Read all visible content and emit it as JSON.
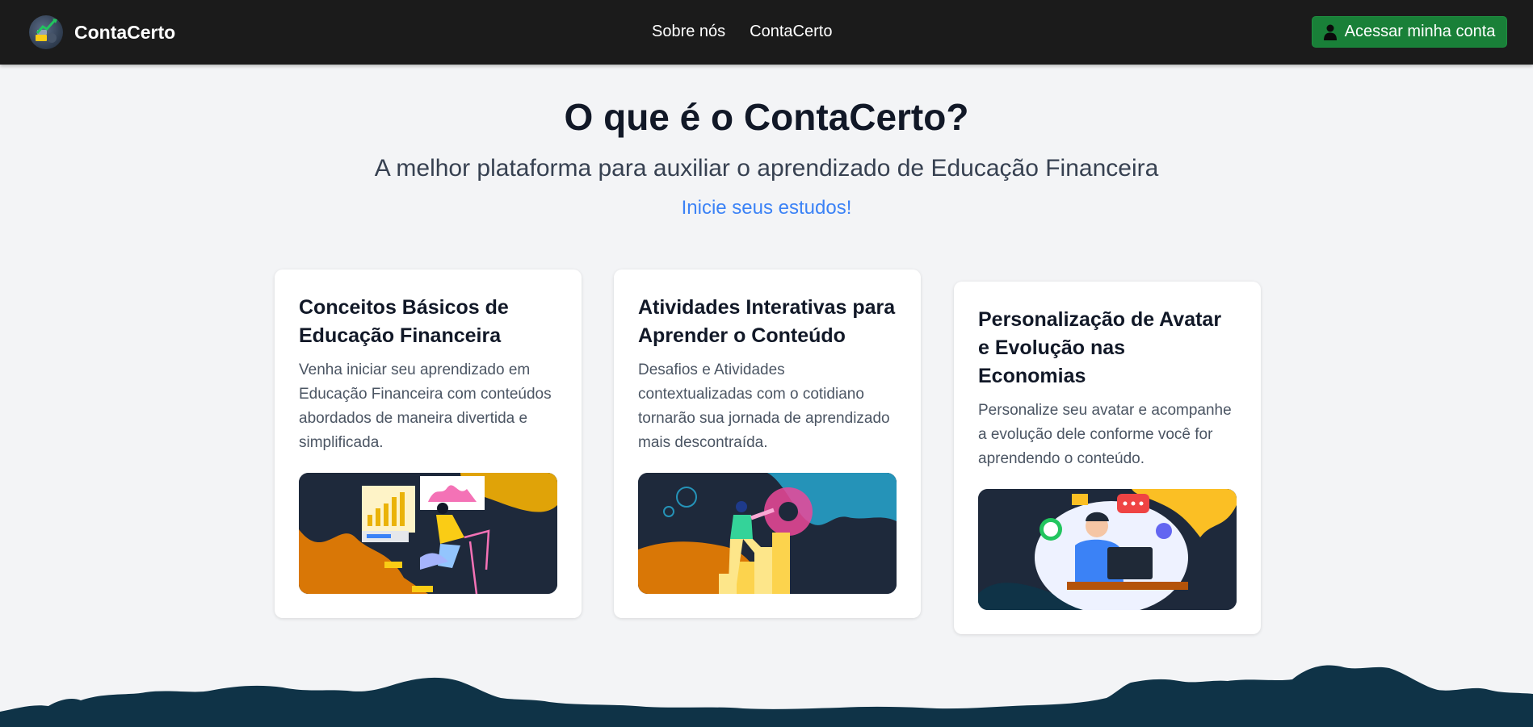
{
  "nav": {
    "brand": "ContaCerto",
    "links": [
      "Sobre nós",
      "ContaCerto"
    ],
    "login_label": "Acessar minha conta",
    "login_icon": "user-icon"
  },
  "hero": {
    "title": "O que é o ContaCerto?",
    "subtitle": "A melhor plataforma para auxiliar o aprendizado de Educação Financeira",
    "cta": "Inicie seus estudos!"
  },
  "cards": [
    {
      "title": "Conceitos Básicos de Educação Financeira",
      "text": "Venha iniciar seu aprendizado em Educação Financeira com conteúdos abordados de maneira divertida e simplificada.",
      "illustration": "person-analyzing-charts-illustration"
    },
    {
      "title": "Atividades Interativas para Aprender o Conteúdo",
      "text": "Desafios e Atividades contextualizadas com o cotidiano tornarão sua jornada de aprendizado mais descontraída.",
      "illustration": "person-climbing-stairs-gear-illustration"
    },
    {
      "title": "Personalização de Avatar e Evolução nas Economias",
      "text": "Personalize seu avatar e acompanhe a evolução dele conforme você for aprendendo o conteúdo.",
      "illustration": "support-agent-computer-illustration"
    }
  ],
  "colors": {
    "navbar": "#1b1b1b",
    "accent_green": "#198038",
    "link_blue": "#3b82f6",
    "footer_wave": "#0f3347",
    "page_bg": "#f3f4f6"
  }
}
